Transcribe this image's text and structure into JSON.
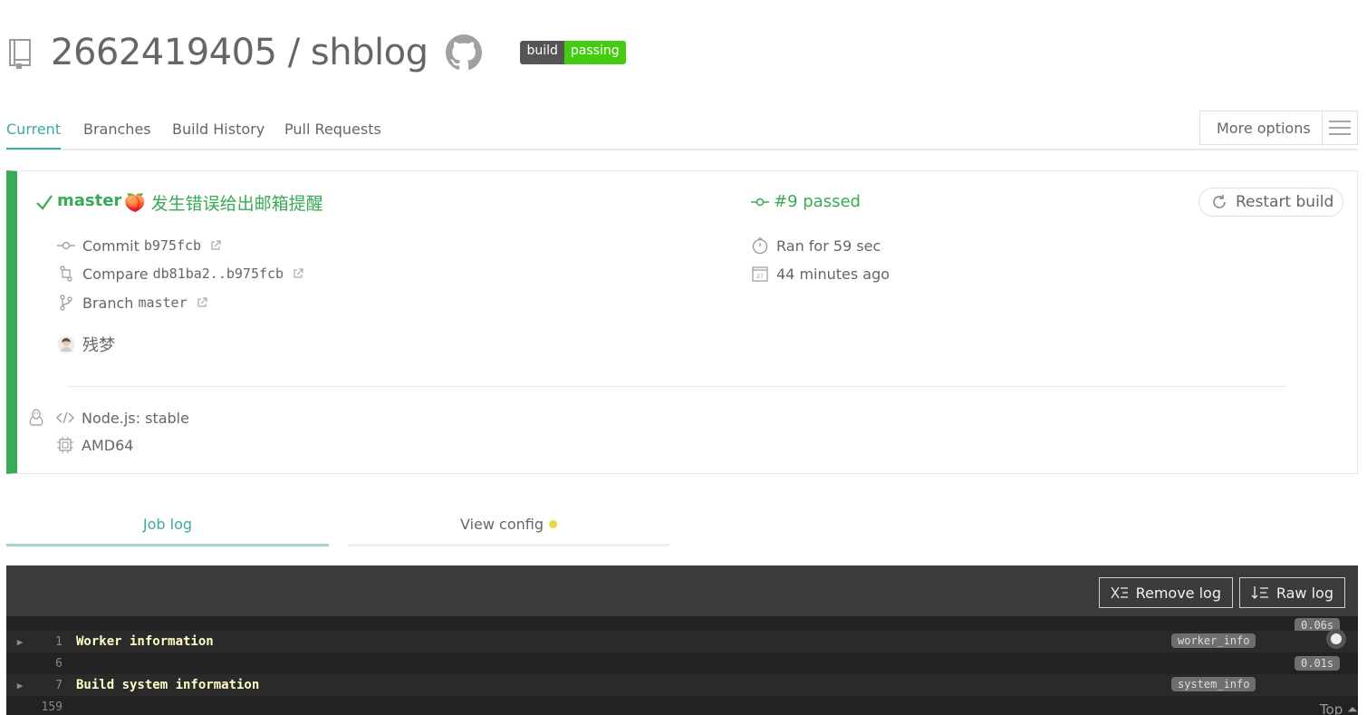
{
  "repo": {
    "owner": "2662419405",
    "separator": "/",
    "name": "shblog",
    "badge_left": "build",
    "badge_right": "passing"
  },
  "tabs": [
    {
      "label": "Current",
      "active": true
    },
    {
      "label": "Branches"
    },
    {
      "label": "Build History"
    },
    {
      "label": "Pull Requests"
    }
  ],
  "more_options": "More options",
  "build": {
    "status_icon": "check-icon",
    "branch": "master",
    "emoji": "🍑",
    "commit_message": "发生错误给出邮箱提醒",
    "number": "#9 passed",
    "restart_label": "Restart build",
    "commit_label": "Commit",
    "commit_sha": "b975fcb",
    "compare_label": "Compare",
    "compare_range": "db81ba2..b975fcb",
    "branch_label": "Branch",
    "branch_value": "master",
    "author": "残梦",
    "duration": "Ran for 59 sec",
    "time_ago": "44 minutes ago",
    "language": "Node.js: stable",
    "arch": "AMD64"
  },
  "job_tabs": {
    "job_log": "Job log",
    "view_config": "View config"
  },
  "log": {
    "remove_log": "Remove log",
    "raw_log": "Raw log",
    "lines": [
      {
        "num": "1",
        "text": "Worker information",
        "tag": "worker_info",
        "time": "0.06s"
      },
      {
        "num": "6",
        "text": "",
        "time": "0.01s"
      },
      {
        "num": "7",
        "text": "Build system information",
        "tag": "system_info"
      },
      {
        "num": "159",
        "text": ""
      }
    ],
    "top_label": "Top"
  },
  "colors": {
    "passed_green": "#39aa56",
    "accent_teal": "#39aaa4",
    "log_bg": "#222222",
    "log_text": "#fffec7"
  }
}
